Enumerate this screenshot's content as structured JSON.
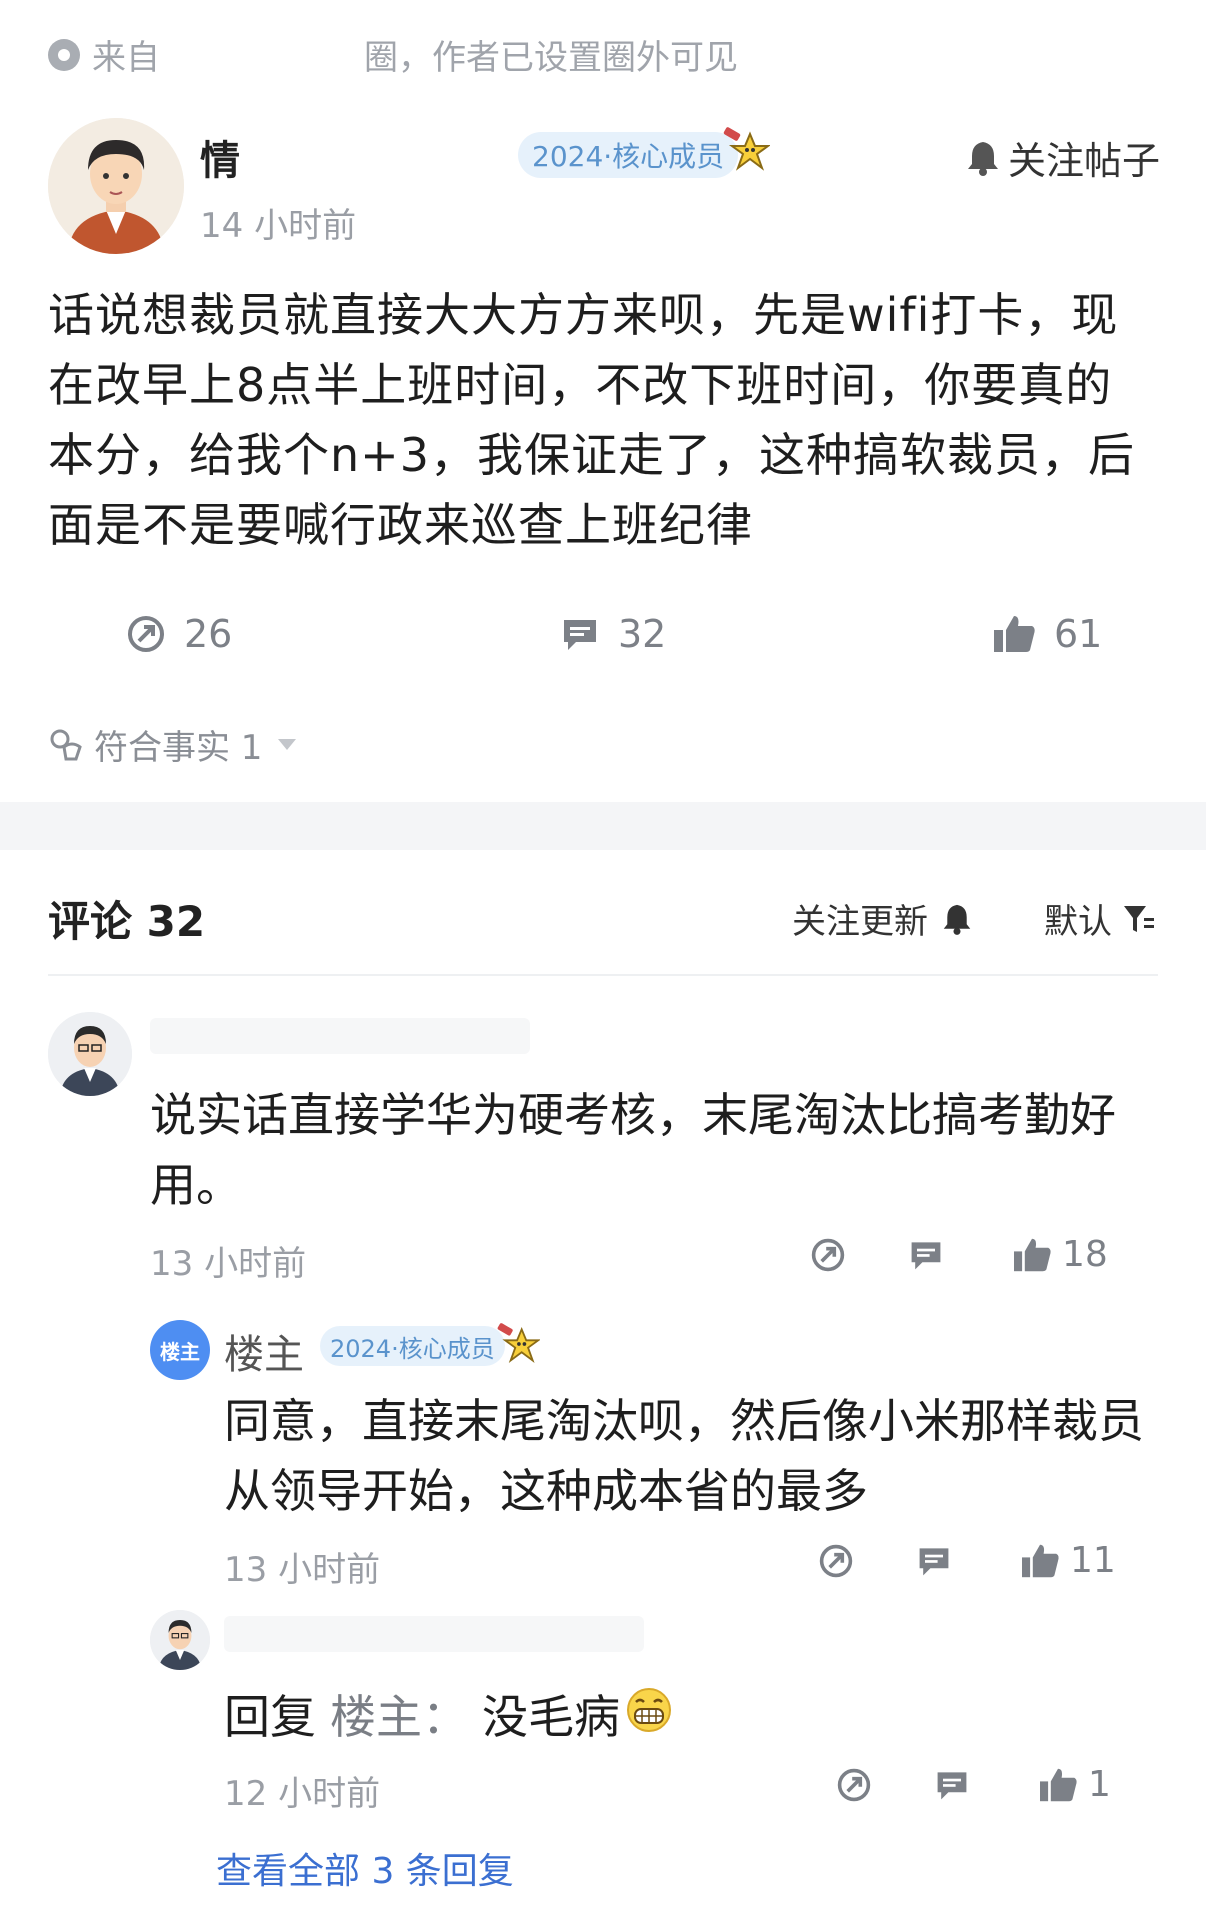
{
  "source": {
    "text": "来自　　　　　　圈，作者已设置圈外可见"
  },
  "post": {
    "author": {
      "name": "情",
      "badge": "2024·核心成员",
      "time": "14 小时前"
    },
    "follow_label": "关注帖子",
    "body": "话说想裁员就直接大大方方来呗，先是wifi打卡，现在改早上8点半上班时间，不改下班时间，你要真的本分，给我个n+3，我保证走了，这种搞软裁员，后面是不是要喊行政来巡查上班纪律",
    "stats": {
      "shares": "26",
      "comments": "32",
      "likes": "61"
    },
    "fact_label": "符合事实 1"
  },
  "comments_header": {
    "title": "评论 32",
    "follow_update": "关注更新",
    "sort": "默认"
  },
  "comment1": {
    "text": "说实话直接学华为硬考核，末尾淘汰比搞考勤好用。",
    "time": "13 小时前",
    "likes": "18"
  },
  "reply1": {
    "tag": "楼主",
    "name": "楼主",
    "badge": "2024·核心成员",
    "text": "同意，直接末尾淘汰呗，然后像小米那样裁员从领导开始，这种成本省的最多",
    "time": "13 小时前",
    "likes": "11"
  },
  "reply2": {
    "prefix": "回复",
    "reply_to": "楼主：",
    "text": "没毛病",
    "time": "12 小时前",
    "likes": "1"
  },
  "view_all": "查看全部 3 条回复",
  "colors": {
    "accent": "#3b6fd1",
    "badge_bg": "#e6f1fb",
    "badge_text": "#5a93cc",
    "louzhu": "#4e8ef2"
  }
}
